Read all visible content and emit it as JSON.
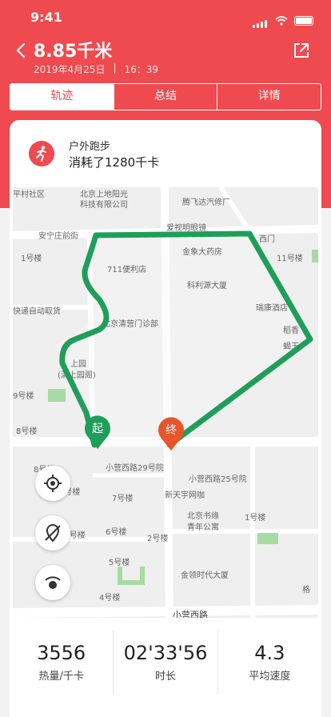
{
  "status_bar": {
    "time": "9:41"
  },
  "header": {
    "title": "8.85千米",
    "date": "2019年4月25日",
    "separator": "|",
    "clock": "16：39"
  },
  "tabs": [
    {
      "label": "轨迹",
      "active": true
    },
    {
      "label": "总结",
      "active": false
    },
    {
      "label": "详情",
      "active": false
    }
  ],
  "activity": {
    "type": "户外跑步",
    "description": "消耗了1280千卡"
  },
  "map": {
    "labels": {
      "l1": "北京上地阳光",
      "l2": "科技有限公司",
      "l3": "腾飞达汽修厂",
      "l4": "爱视明眼镜",
      "l5": "安宁庄前街",
      "l6": "西门",
      "l7": "金象大药房",
      "l8": "1号楼",
      "l9": "11号楼",
      "l10": "711便利店",
      "l11": "科利源大厦",
      "l12": "快递自动取货",
      "l13": "瑞康酒店",
      "l14": "北京清营门诊部",
      "l15": "稻香",
      "l16": "蝎王",
      "l17": "上园",
      "l18": "(清上园阁)",
      "l19": "9号楼",
      "l20": "8号楼",
      "l21": "小营西路29号院",
      "l22": "7号楼",
      "l23": "小营西路25号院",
      "l24": "新天宇网咖",
      "l25": "北京书缘",
      "l26": "青年公寓",
      "l27": "1号楼",
      "l28": "6号楼",
      "l29": "2号楼",
      "l30": "5号楼",
      "l31": "金领时代大厦",
      "l32": "4号楼",
      "l33": "小营西路",
      "l34": "格",
      "l35": "平村社区",
      "l36": "8号楼",
      "l37": "10号楼",
      "l38": "9号楼"
    },
    "start_marker": "起",
    "end_marker": "终",
    "route_color": "#1f9e5a",
    "controls": [
      "locate-icon",
      "hide-route-icon",
      "signal-icon"
    ]
  },
  "stats": [
    {
      "value": "3556",
      "label": "热量/千卡"
    },
    {
      "value": "02'33'56",
      "label": "时长"
    },
    {
      "value": "4.3",
      "label": "平均速度"
    }
  ]
}
